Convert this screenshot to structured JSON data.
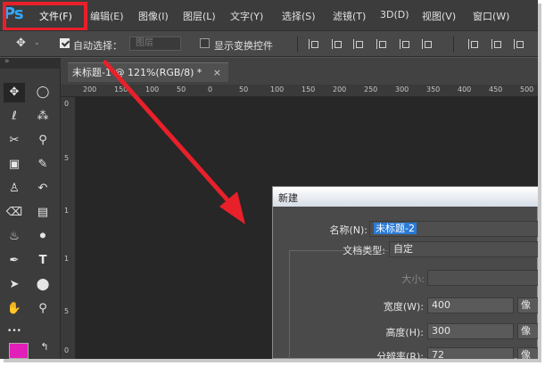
{
  "app": {
    "logo": "Ps",
    "menu": [
      "文件(F)",
      "编辑(E)",
      "图像(I)",
      "图层(L)",
      "文字(Y)",
      "选择(S)",
      "滤镜(T)",
      "3D(D)",
      "视图(V)",
      "窗口(W)"
    ]
  },
  "options_bar": {
    "move_icon": "move-icon",
    "auto_select_label": "自动选择：",
    "auto_select_checked": true,
    "auto_select_value": "图层",
    "show_transform_label": "显示变换控件",
    "show_transform_checked": false
  },
  "toolbar": {
    "collapse_glyph": "»",
    "tools": [
      {
        "name": "move-tool-icon",
        "glyph": "✥",
        "selected": true
      },
      {
        "name": "marquee-tool-icon",
        "glyph": "◯"
      },
      {
        "name": "lasso-tool-icon",
        "glyph": "ℓ"
      },
      {
        "name": "magic-wand-tool-icon",
        "glyph": "⁂"
      },
      {
        "name": "crop-tool-icon",
        "glyph": "✂"
      },
      {
        "name": "eyedropper-tool-icon",
        "glyph": "⚲"
      },
      {
        "name": "healing-brush-tool-icon",
        "glyph": "▣"
      },
      {
        "name": "brush-tool-icon",
        "glyph": "✎"
      },
      {
        "name": "clone-stamp-tool-icon",
        "glyph": "♙"
      },
      {
        "name": "history-brush-tool-icon",
        "glyph": "↶"
      },
      {
        "name": "eraser-tool-icon",
        "glyph": "⌫"
      },
      {
        "name": "gradient-tool-icon",
        "glyph": "▤"
      },
      {
        "name": "blur-tool-icon",
        "glyph": "♨"
      },
      {
        "name": "dodge-tool-icon",
        "glyph": "⚫"
      },
      {
        "name": "pen-tool-icon",
        "glyph": "✒"
      },
      {
        "name": "type-tool-icon",
        "glyph": "T"
      },
      {
        "name": "path-selection-tool-icon",
        "glyph": "➤"
      },
      {
        "name": "shape-tool-icon",
        "glyph": "⬤"
      },
      {
        "name": "hand-tool-icon",
        "glyph": "✋"
      },
      {
        "name": "zoom-tool-icon",
        "glyph": "⚲"
      },
      {
        "name": "more-tools-icon",
        "glyph": "•••"
      }
    ],
    "foreground_color": "#e21fb8",
    "swap_icon": "↰"
  },
  "document": {
    "tab_title": "未标题-1 @ 121%(RGB/8) *",
    "close_glyph": "×",
    "ruler_top_labels": [
      "200",
      "150",
      "100",
      "50",
      "0",
      "50",
      "100",
      "150",
      "200",
      "250",
      "300",
      "350",
      "400",
      "450",
      "500"
    ],
    "ruler_left_labels": [
      "0",
      "5",
      "1",
      "1",
      "5",
      "0"
    ]
  },
  "dialog": {
    "title": "新建",
    "name_label": "名称(N):",
    "name_value": "未标题-2",
    "doc_type_label": "文档类型:",
    "doc_type_value": "自定",
    "size_label": "大小:",
    "width_label": "宽度(W):",
    "width_value": "400",
    "height_label": "高度(H):",
    "height_value": "300",
    "resolution_label": "分辨率(R):",
    "resolution_value": "72",
    "unit_glyph": "像"
  },
  "annotation": {
    "arrow_color": "#e8202a"
  }
}
